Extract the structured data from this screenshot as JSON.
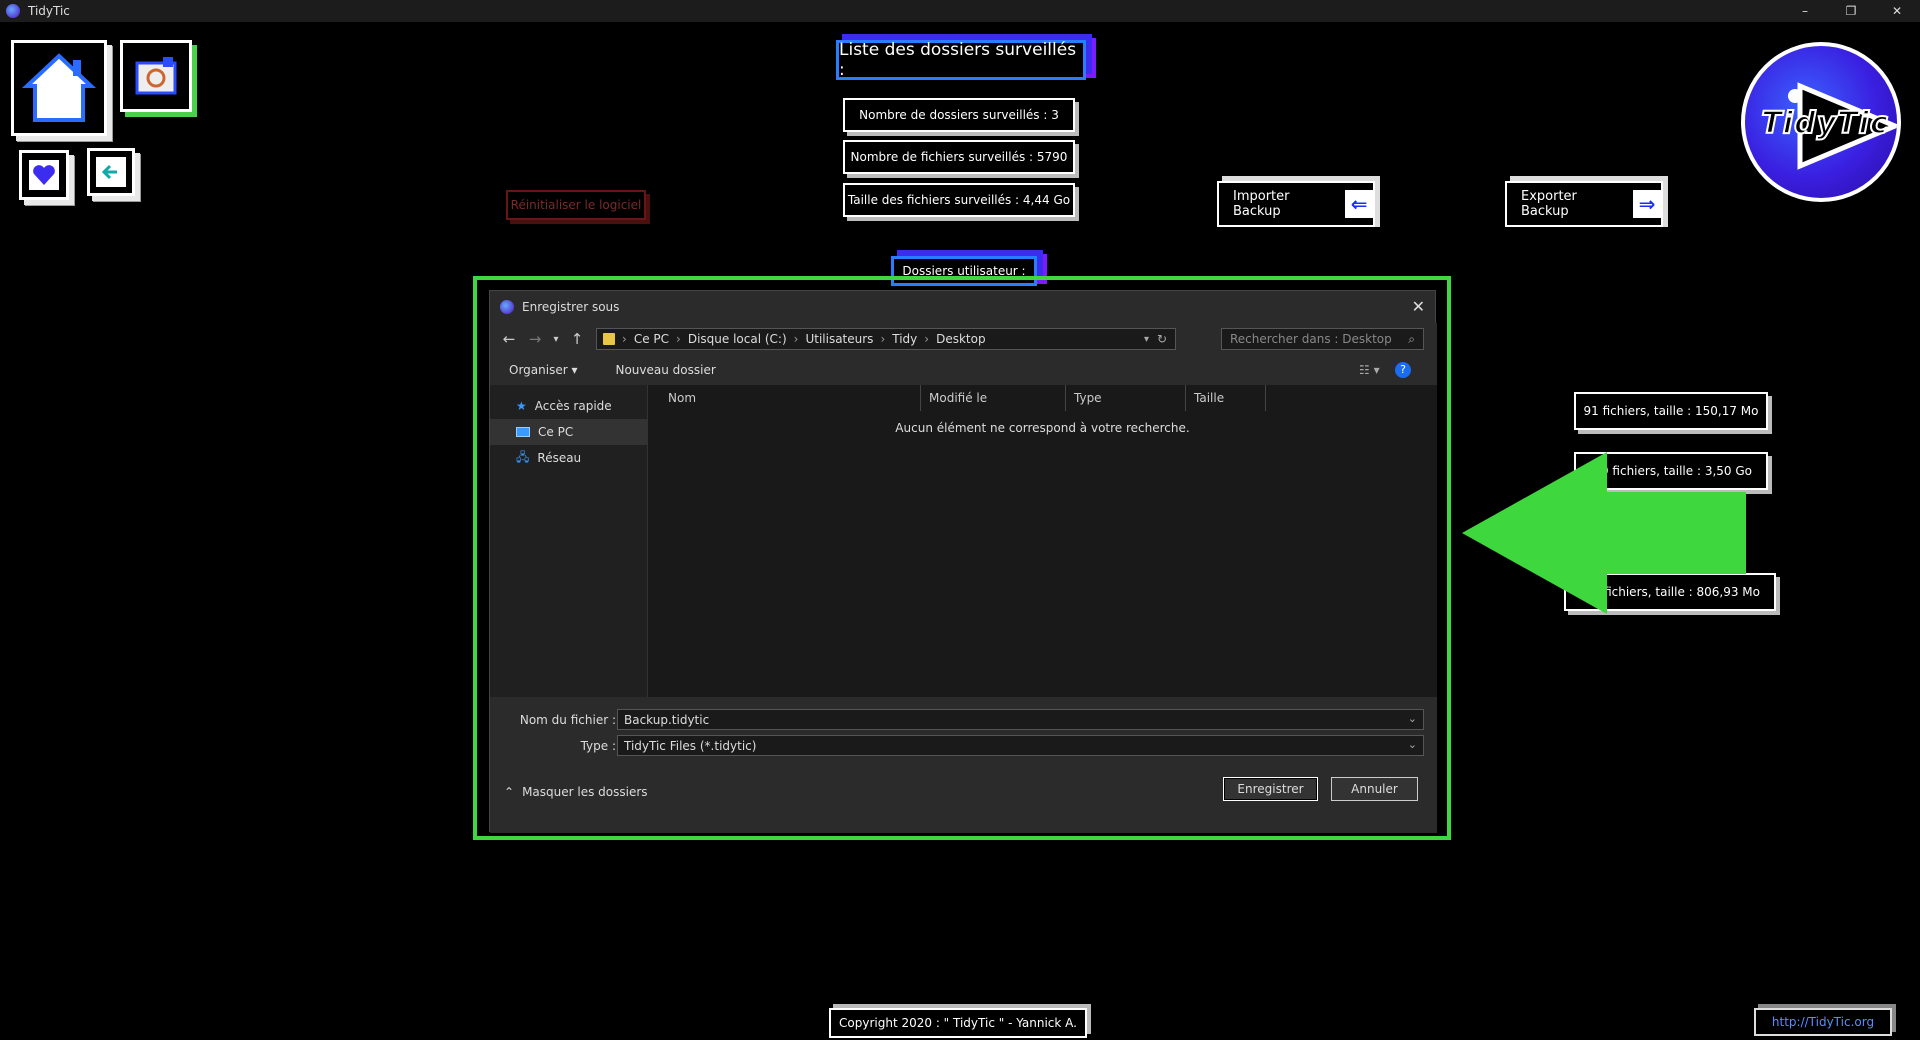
{
  "window": {
    "title": "TidyTic",
    "controls": [
      "–",
      "❐",
      "✕"
    ]
  },
  "header": {
    "title": "Liste des dossiers surveillés :"
  },
  "stats": {
    "count": "Nombre de dossiers surveillés : 3",
    "files": "Nombre de fichiers surveillés : 5790",
    "size": "Taille des fichiers surveillés : 4,44 Go"
  },
  "buttons": {
    "reset": "Réinitialiser le logiciel",
    "import_backup": "Importer Backup",
    "export_backup": "Exporter Backup",
    "user_folders": "Dossiers utilisateur :"
  },
  "folders": [
    "91 fichiers, taille : 150,17 Mo",
    "59 fichiers, taille : 3,50 Go",
    "0 fichiers, taille : 806,93 Mo"
  ],
  "logo": {
    "text": "TidyTic"
  },
  "dialog": {
    "title": "Enregistrer sous",
    "breadcrumb": [
      "Ce PC",
      "Disque local (C:)",
      "Utilisateurs",
      "Tidy",
      "Desktop"
    ],
    "search_placeholder": "Rechercher dans : Desktop",
    "organize": "Organiser ▾",
    "new_folder": "Nouveau dossier",
    "sidebar": [
      {
        "label": "Accès rapide",
        "icon": "star-icon"
      },
      {
        "label": "Ce PC",
        "icon": "pc-icon"
      },
      {
        "label": "Réseau",
        "icon": "network-icon"
      }
    ],
    "columns": [
      "Nom",
      "Modifié le",
      "Type",
      "Taille"
    ],
    "empty_message": "Aucun élément ne correspond à votre recherche.",
    "filename_label": "Nom du fichier :",
    "filename_value": "Backup.tidytic",
    "type_label": "Type :",
    "type_value": "TidyTic Files (*.tidytic)",
    "hide_folders": "Masquer les dossiers",
    "save": "Enregistrer",
    "cancel": "Annuler"
  },
  "footer": {
    "copyright": "Copyright 2020 : \" TidyTic \" - Yannick A.",
    "link": "http://TidyTic.org"
  },
  "colors": {
    "highlight": "#3ed83e",
    "accent": "#3b2cf0",
    "link": "#5b8cff"
  }
}
